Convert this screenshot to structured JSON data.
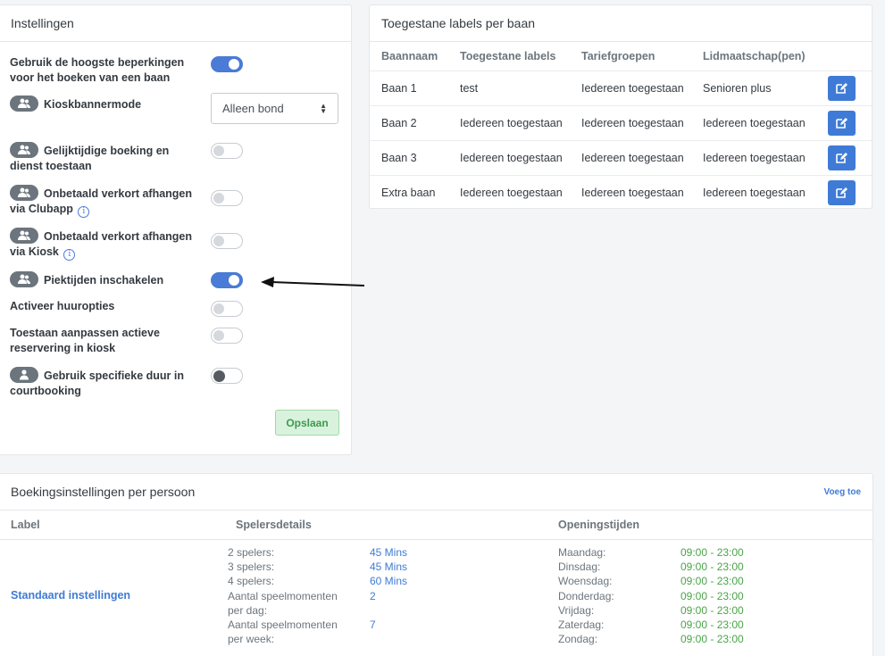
{
  "settings": {
    "title": "Instellingen",
    "rows": [
      {
        "label": "Gebruik de hoogste beperkingen voor het boeken van een baan"
      },
      {
        "label": "Kioskbannermode"
      },
      {
        "label": "Gelijktijdige boeking en dienst toestaan"
      },
      {
        "label": "Onbetaald verkort afhangen via Clubapp"
      },
      {
        "label": "Onbetaald verkort afhangen via Kiosk"
      },
      {
        "label": "Piektijden inschakelen"
      },
      {
        "label": "Activeer huuropties"
      },
      {
        "label": "Toestaan aanpassen actieve reservering in kiosk"
      },
      {
        "label": "Gebruik specifieke duur in courtbooking"
      }
    ],
    "select_value": "Alleen bond",
    "save_label": "Opslaan",
    "info_glyph": "i"
  },
  "labels": {
    "title": "Toegestane labels per baan",
    "columns": [
      "Baannaam",
      "Toegestane labels",
      "Tariefgroepen",
      "Lidmaatschap(pen)"
    ],
    "rows": [
      [
        "Baan 1",
        "test",
        "Iedereen toegestaan",
        "Senioren plus"
      ],
      [
        "Baan 2",
        "Iedereen toegestaan",
        "Iedereen toegestaan",
        "Iedereen toegestaan"
      ],
      [
        "Baan 3",
        "Iedereen toegestaan",
        "Iedereen toegestaan",
        "Iedereen toegestaan"
      ],
      [
        "Extra baan",
        "Iedereen toegestaan",
        "Iedereen toegestaan",
        "Iedereen toegestaan"
      ]
    ]
  },
  "bookings": {
    "title": "Boekingsinstellingen per persoon",
    "add_label": "Voeg toe",
    "columns": [
      "Label",
      "Spelersdetails",
      "Openingstijden"
    ],
    "row_label": "Standaard instellingen",
    "details": [
      {
        "k": "2 spelers:",
        "v": "45 Mins"
      },
      {
        "k": "3 spelers:",
        "v": "45 Mins"
      },
      {
        "k": "4 spelers:",
        "v": "60 Mins"
      },
      {
        "k": "Aantal speelmomenten per dag:",
        "v": "2"
      },
      {
        "k": "Aantal speelmomenten per week:",
        "v": "7"
      }
    ],
    "hours": [
      {
        "d": "Maandag:",
        "t": "09:00 - 23:00"
      },
      {
        "d": "Dinsdag:",
        "t": "09:00 - 23:00"
      },
      {
        "d": "Woensdag:",
        "t": "09:00 - 23:00"
      },
      {
        "d": "Donderdag:",
        "t": "09:00 - 23:00"
      },
      {
        "d": "Vrijdag:",
        "t": "09:00 - 23:00"
      },
      {
        "d": "Zaterdag:",
        "t": "09:00 - 23:00"
      },
      {
        "d": "Zondag:",
        "t": "09:00 - 23:00"
      }
    ]
  },
  "colors": {
    "accent": "#3f7bd6",
    "success": "#4aa448",
    "badge": "#6c757d"
  }
}
